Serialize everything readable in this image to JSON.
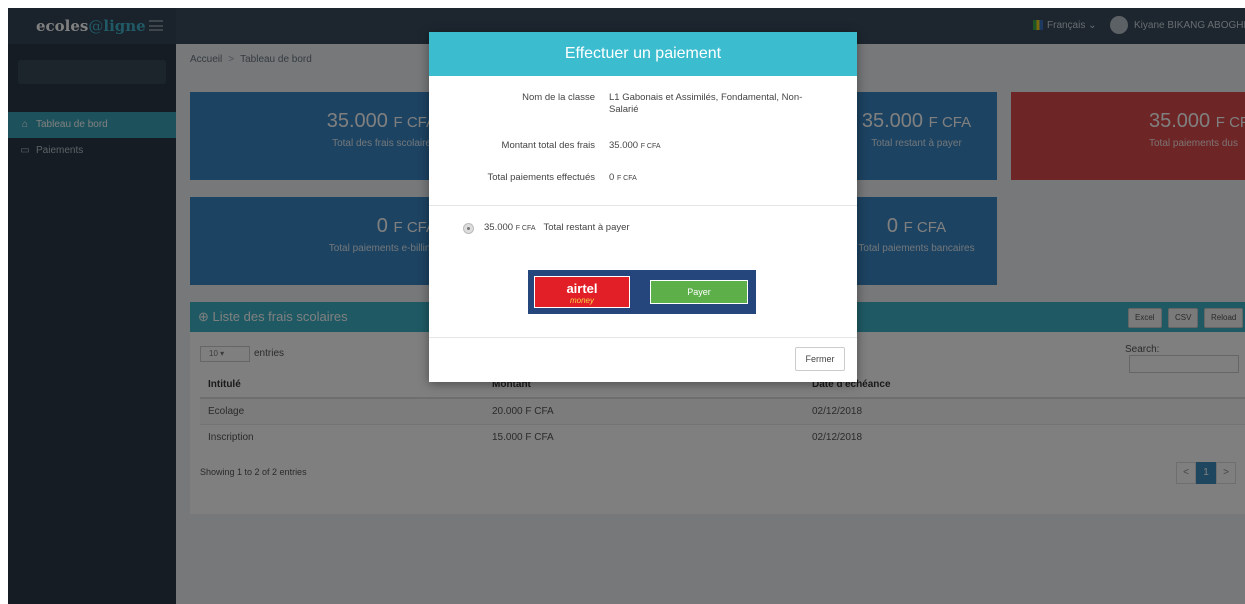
{
  "app": {
    "logo_part1": "ecoles",
    "logo_at": "@",
    "logo_part2": "ligne"
  },
  "topbar": {
    "language": "Français",
    "language_caret": "⌄",
    "user_name": "Kiyane BIKANG ABOGHE"
  },
  "sidebar": {
    "items": [
      {
        "label": "Tableau de bord",
        "icon": "home-icon"
      },
      {
        "label": "Paiements",
        "icon": "card-icon"
      }
    ]
  },
  "breadcrumb": {
    "home": "Accueil",
    "separator": ">",
    "current": "Tableau de bord"
  },
  "tiles": [
    {
      "amount": "35.000",
      "unit": "F CFA",
      "label": "Total des frais scolaires",
      "color": "#3a87c4"
    },
    {
      "amount": "35.000",
      "unit": "F CFA",
      "label": "Total restant à payer",
      "color": "#3a87c4"
    },
    {
      "amount": "35.000",
      "unit": "F CFA",
      "label": "Total paiements dus",
      "color": "#dd4b4b"
    },
    {
      "amount": "0",
      "unit": "F CFA",
      "label": "Total paiements e-billing",
      "color": "#3a87c4"
    },
    {
      "amount": "0",
      "unit": "F CFA",
      "label": "Total paiements bancaires",
      "color": "#3a87c4"
    }
  ],
  "panel": {
    "title": "Liste des frais scolaires",
    "buttons": [
      "Excel",
      "CSV",
      "Reload"
    ],
    "entries_value": "10",
    "entries_label": "entries",
    "search_label": "Search:",
    "columns": [
      "Intitulé",
      "Montant",
      "Date d'échéance"
    ],
    "rows": [
      [
        "Ecolage",
        "20.000 F CFA",
        "02/12/2018"
      ],
      [
        "Inscription",
        "15.000 F CFA",
        "02/12/2018"
      ]
    ],
    "showing": "Showing 1 to 2 of 2 entries",
    "pager": [
      "<",
      "1",
      ">"
    ]
  },
  "modal": {
    "title": "Effectuer un paiement",
    "class_label": "Nom de la classe",
    "class_value": "L1 Gabonais et Assimilés, Fondamental, Non-Salarié",
    "total_label": "Montant total des frais",
    "total_value": "35.000",
    "total_unit": "F CFA",
    "paid_label": "Total paiements effectués",
    "paid_value": "0",
    "paid_unit": "F CFA",
    "remaining_value": "35.000",
    "remaining_unit": "F CFA",
    "remaining_label": "Total restant à payer",
    "airtel_brand": "airtel",
    "airtel_sub": "money",
    "pay_button": "Payer",
    "close_button": "Fermer"
  }
}
